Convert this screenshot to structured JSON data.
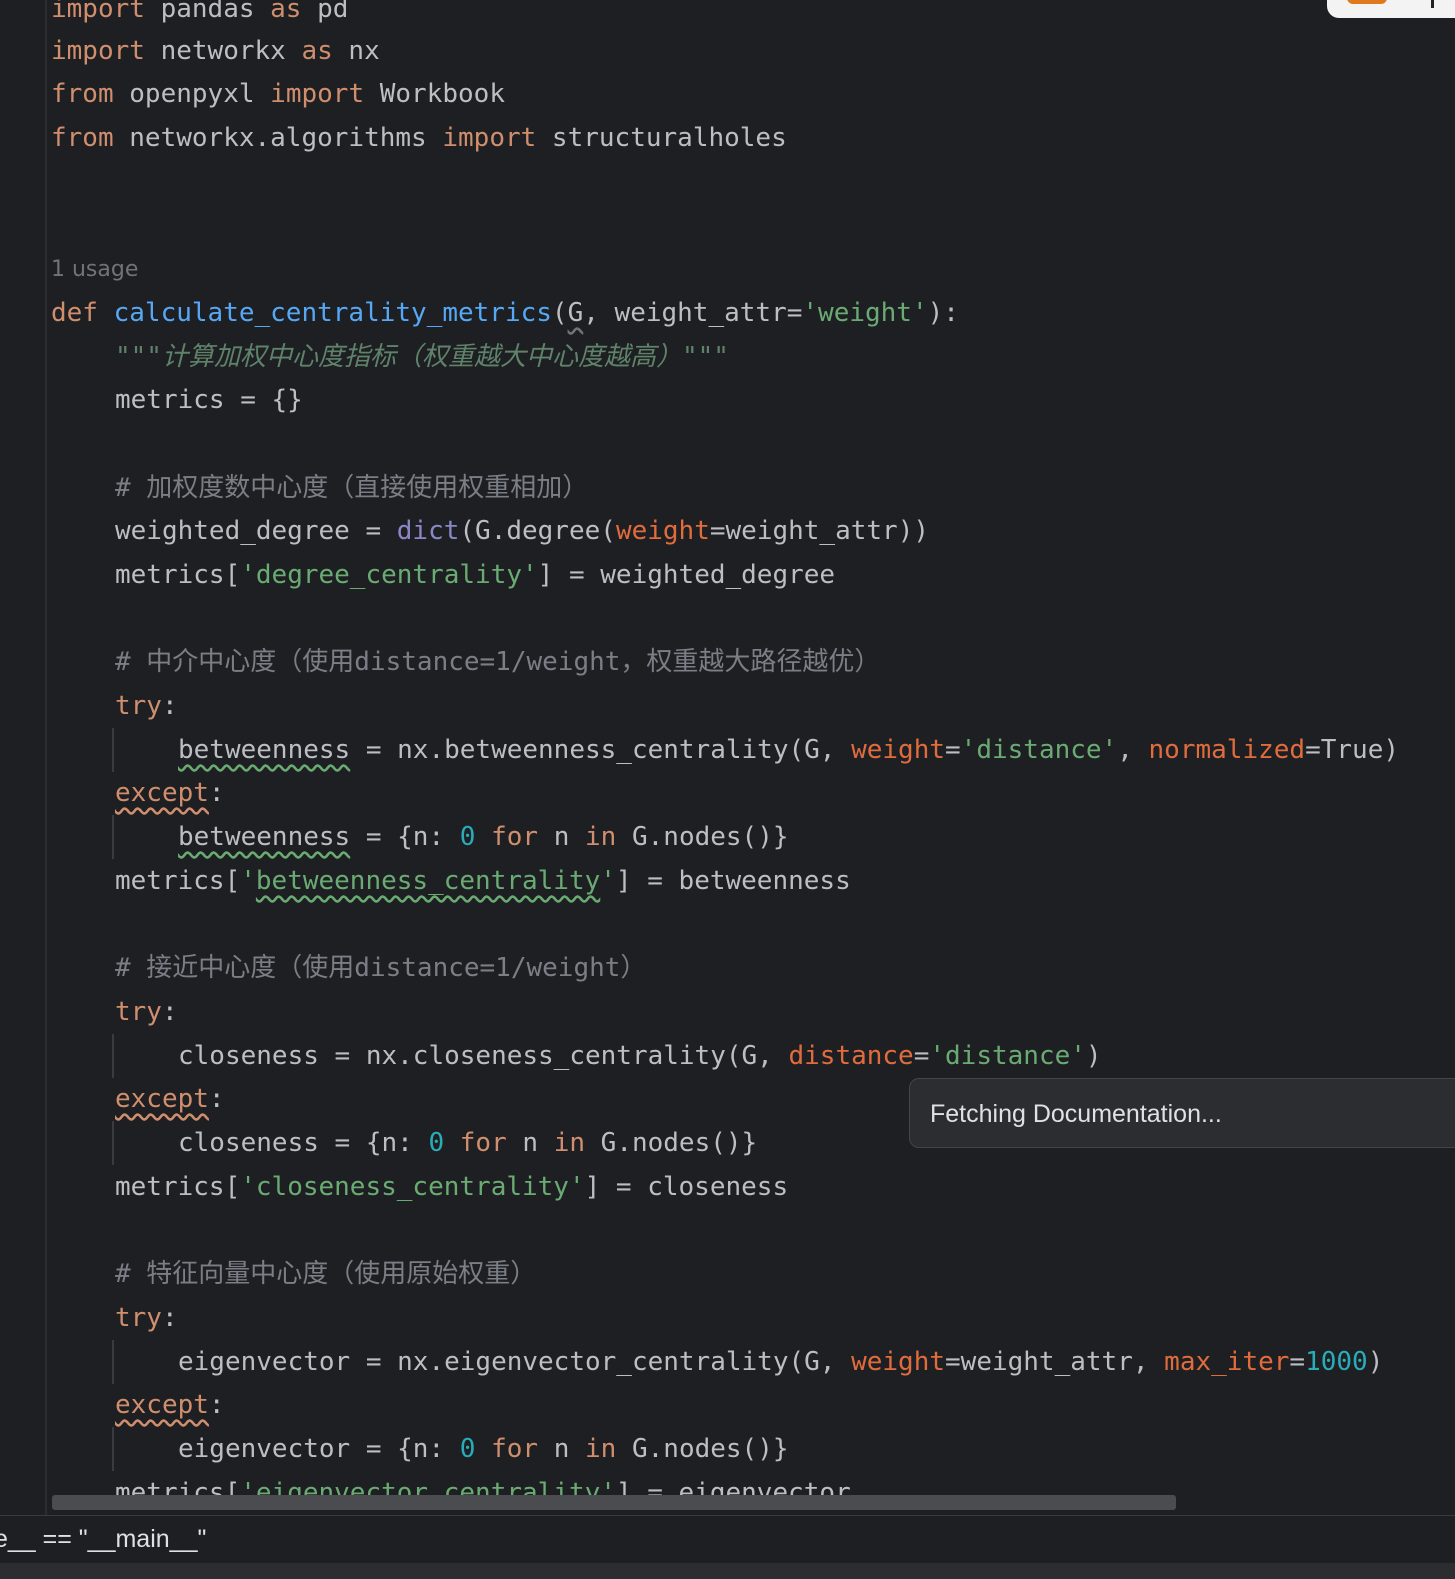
{
  "editor": {
    "imports": {
      "l1": {
        "kw1": "import",
        "mod": " pandas ",
        "kw2": "as",
        "alias": " pd"
      },
      "l2": {
        "kw1": "import",
        "mod": " networkx ",
        "kw2": "as",
        "alias": " nx"
      },
      "l3": {
        "kw1": "from",
        "mod": " openpyxl ",
        "kw2": "import",
        "name": " Workbook"
      },
      "l4": {
        "kw1": "from",
        "mod": " networkx.algorithms ",
        "kw2": "import",
        "name": " structuralholes"
      }
    },
    "usage_hint": "1 usage",
    "def": {
      "kw": "def",
      "name": "calculate_centrality_metrics",
      "open": "(",
      "g": "G",
      "mid": ", weight_attr=",
      "str": "'weight'",
      "close": "):"
    },
    "docstring": "\"\"\"计算加权中心度指标（权重越大中心度越高）\"\"\"",
    "metrics_init": "metrics = {}",
    "degree_block": {
      "comment": "# 加权度数中心度（直接使用权重相加）",
      "l1": {
        "a": "weighted_degree = ",
        "bi": "dict",
        "b": "(G.degree(",
        "p": "weight",
        "c": "=weight_attr))"
      },
      "l2": {
        "a": "metrics[",
        "s": "'degree_centrality'",
        "b": "] = weighted_degree"
      }
    },
    "betweenness_block": {
      "comment": "# 中介中心度（使用distance=1/weight，权重越大路径越优）",
      "try": "try",
      "colon": ":",
      "l1": {
        "var": "betweenness",
        "a": " = nx.betweenness_centrality(G, ",
        "p1": "weight",
        "eq1": "=",
        "s1": "'distance'",
        "sep": ", ",
        "p2": "normalized",
        "tail": "=True)"
      },
      "except": "except",
      "l2": {
        "var": "betweenness",
        "a": " = {n: ",
        "num": "0",
        "sp1": " ",
        "kw1": "for",
        "b": " n ",
        "kw2": "in",
        "c": " G.nodes()}"
      },
      "l3": {
        "a": "metrics[",
        "q1": "'",
        "s": "betweenness_centrality",
        "q2": "'",
        "b": "] = betweenness"
      }
    },
    "closeness_block": {
      "comment": "# 接近中心度（使用distance=1/weight）",
      "try": "try",
      "colon": ":",
      "l1": {
        "a": "closeness = nx.closeness_centrality(G, ",
        "p": "distance",
        "eq": "=",
        "s": "'distance'",
        "tail": ")"
      },
      "except": "except",
      "l2": {
        "a": "closeness = {n: ",
        "num": "0",
        "sp1": " ",
        "kw1": "for",
        "b": " n ",
        "kw2": "in",
        "c": " G.nodes()}"
      },
      "l3": {
        "a": "metrics[",
        "s": "'closeness_centrality'",
        "b": "] = closeness"
      }
    },
    "eigen_block": {
      "comment": "# 特征向量中心度（使用原始权重）",
      "try": "try",
      "colon": ":",
      "l1": {
        "a": "eigenvector = nx.eigenvector_centrality(G, ",
        "p1": "weight",
        "b": "=weight_attr, ",
        "p2": "max_iter",
        "eq": "=",
        "num": "1000",
        "tail": ")"
      },
      "except": "except",
      "l2": {
        "a": "eigenvector = {n: ",
        "num": "0",
        "sp1": " ",
        "kw1": "for",
        "b": " n ",
        "kw2": "in",
        "c": " G.nodes()}"
      },
      "l3": {
        "a": "metrics[",
        "s": "'eigenvector_centrality'",
        "b": "] = eigenvector"
      }
    }
  },
  "popup": {
    "text": "Fetching Documentation..."
  },
  "status_bar": {
    "text": "e__ == \"__main__\""
  },
  "colors": {
    "background": "#1e1f22",
    "keyword": "#cf8e6d",
    "function": "#56a8f5",
    "string": "#6aab73",
    "number": "#2aacb8",
    "parameter": "#e06c3e",
    "builtin": "#8888c6",
    "comment": "#7a7e85"
  }
}
